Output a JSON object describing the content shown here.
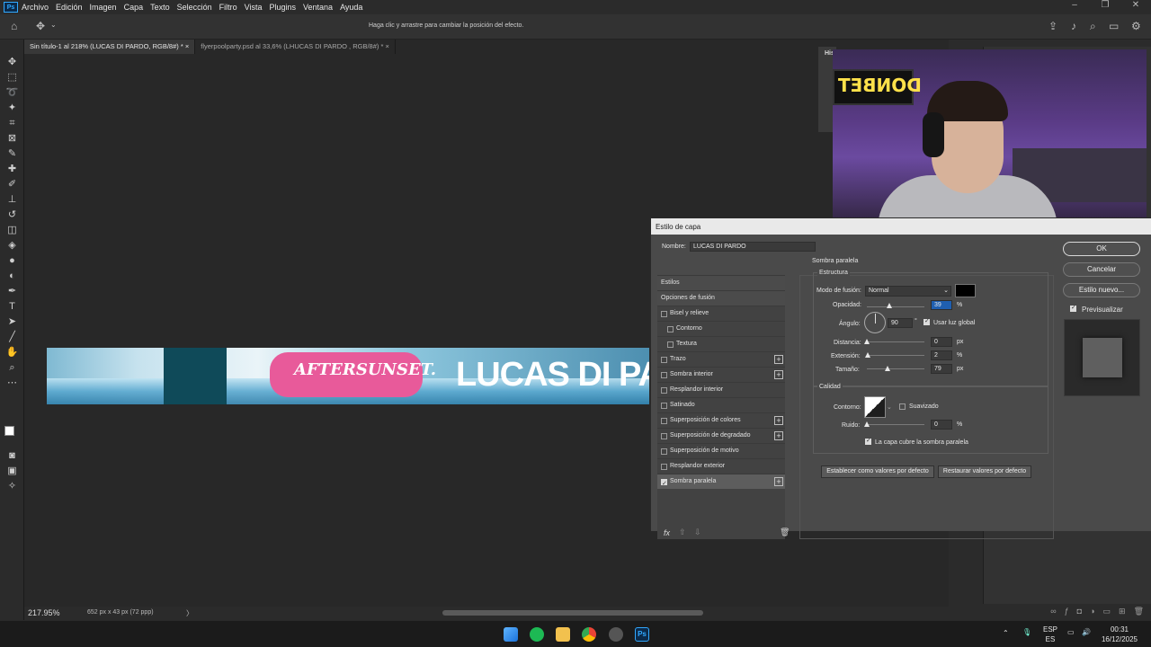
{
  "app": {
    "logo": "Ps",
    "menu": [
      "Archivo",
      "Edición",
      "Imagen",
      "Capa",
      "Texto",
      "Selección",
      "Filtro",
      "Vista",
      "Plugins",
      "Ventana",
      "Ayuda"
    ],
    "hint": "Haga clic y arrastre para cambiar la posición del efecto."
  },
  "tabs": [
    {
      "label": "Sin título-1 al 218% (LUCAS DI PARDO, RGB/8#) *",
      "close": "×",
      "active": true
    },
    {
      "label": "flyerpoolparty.psd al 33,6% (LHUCAS DI PARDO , RGB/8#) *",
      "close": "×",
      "active": false
    }
  ],
  "canvas": {
    "banner_script": "AFTERSUNSET.",
    "banner_title": "LUCAS DI PARDO"
  },
  "status": {
    "zoom": "217.95%",
    "docinfo": "652 px x 43 px (72 ppp)",
    "arrow": "〉"
  },
  "history_panel": {
    "label": "His"
  },
  "webcam": {
    "sign_text": "DONBET"
  },
  "dialog": {
    "title": "Estilo de capa",
    "name_label": "Nombre:",
    "name_value": "LUCAS DI PARDO",
    "styles": [
      {
        "label": "Estilos",
        "type": "header"
      },
      {
        "label": "Opciones de fusión",
        "type": "header"
      },
      {
        "label": "Bisel y relieve",
        "checked": false,
        "plus": false
      },
      {
        "label": "Contorno",
        "checked": false,
        "indent": true
      },
      {
        "label": "Textura",
        "checked": false,
        "indent": true
      },
      {
        "label": "Trazo",
        "checked": false,
        "plus": true
      },
      {
        "label": "Sombra interior",
        "checked": false,
        "plus": true
      },
      {
        "label": "Resplandor interior",
        "checked": false
      },
      {
        "label": "Satinado",
        "checked": false
      },
      {
        "label": "Superposición de colores",
        "checked": false,
        "plus": true
      },
      {
        "label": "Superposición de degradado",
        "checked": false,
        "plus": true
      },
      {
        "label": "Superposición de motivo",
        "checked": false
      },
      {
        "label": "Resplandor exterior",
        "checked": false
      },
      {
        "label": "Sombra paralela",
        "checked": true,
        "plus": true,
        "selected": true
      }
    ],
    "section_title": "Sombra paralela",
    "estructura": {
      "title": "Estructura",
      "blend_label": "Modo de fusión:",
      "blend_value": "Normal",
      "shadow_color": "#000000",
      "opacity_label": "Opacidad:",
      "opacity_value": "39",
      "opacity_unit": "%",
      "angle_label": "Ángulo:",
      "angle_value": "90",
      "angle_unit": "°",
      "global_light_label": "Usar luz global",
      "global_light_checked": true,
      "distance_label": "Distancia:",
      "distance_value": "0",
      "distance_unit": "px",
      "spread_label": "Extensión:",
      "spread_value": "2",
      "spread_unit": "%",
      "size_label": "Tamaño:",
      "size_value": "79",
      "size_unit": "px"
    },
    "calidad": {
      "title": "Calidad",
      "contour_label": "Contorno:",
      "antialias_label": "Suavizado",
      "antialias_checked": false,
      "noise_label": "Ruido:",
      "noise_value": "0",
      "noise_unit": "%",
      "knockout_label": "La capa cubre la sombra paralela",
      "knockout_checked": true
    },
    "default_set_label": "Establecer como valores por defecto",
    "default_reset_label": "Restaurar valores por defecto",
    "ok_label": "OK",
    "cancel_label": "Cancelar",
    "new_style_label": "Estilo nuevo...",
    "preview_label": "Previsualizar",
    "preview_checked": true,
    "fx_label": "fx"
  },
  "taskbar": {
    "lang_top": "ESP",
    "lang_bottom": "ES",
    "time": "00:31",
    "date": "16/12/2025"
  }
}
